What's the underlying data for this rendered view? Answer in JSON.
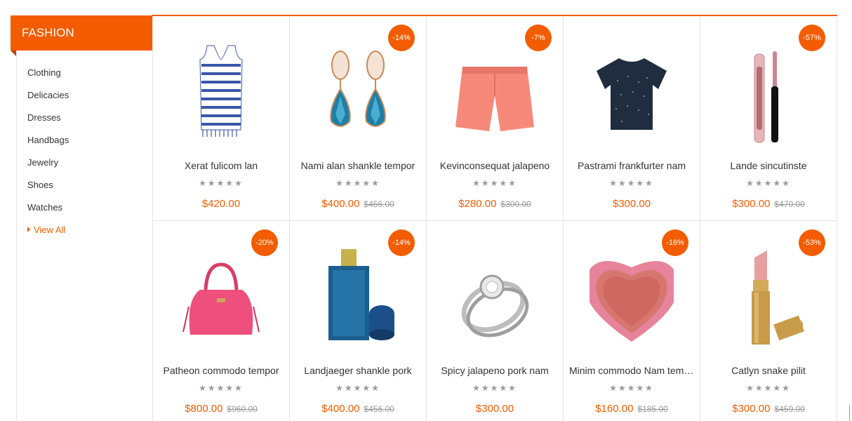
{
  "sidebar": {
    "title": "FASHION",
    "items": [
      "Clothing",
      "Delicacies",
      "Dresses",
      "Handbags",
      "Jewelry",
      "Shoes",
      "Watches"
    ],
    "view_all": "View All"
  },
  "colors": {
    "accent": "#f35c00",
    "border": "#e5e5e5"
  },
  "products": [
    {
      "name": "Xerat fulicom lan",
      "price": "$420.00",
      "old_price": "",
      "badge": "",
      "image": "striped-tank-top",
      "rating": 0
    },
    {
      "name": "Nami alan shankle tempor",
      "price": "$400.00",
      "old_price": "$456.00",
      "badge": "-14%",
      "image": "blue-crystal-earrings",
      "rating": 0
    },
    {
      "name": "Kevinconsequat jalapeno",
      "price": "$280.00",
      "old_price": "$300.00",
      "badge": "-7%",
      "image": "coral-shorts",
      "rating": 0
    },
    {
      "name": "Pastrami frankfurter nam",
      "price": "$300.00",
      "old_price": "",
      "badge": "",
      "image": "navy-tshirt",
      "rating": 0
    },
    {
      "name": "Lande sincutinste",
      "price": "$300.00",
      "old_price": "$470.00",
      "badge": "-57%",
      "image": "lip-gloss",
      "rating": 0
    },
    {
      "name": "Patheon commodo tempor",
      "price": "$800.00",
      "old_price": "$960.00",
      "badge": "-20%",
      "image": "pink-handbag",
      "rating": 0
    },
    {
      "name": "Landjaeger shankle pork",
      "price": "$400.00",
      "old_price": "$456.00",
      "badge": "-14%",
      "image": "perfume-bottle",
      "rating": 0
    },
    {
      "name": "Spicy jalapeno pork nam",
      "price": "$300.00",
      "old_price": "",
      "badge": "",
      "image": "diamond-ring",
      "rating": 0
    },
    {
      "name": "Minim commodo Nam tempor",
      "price": "$160.00",
      "old_price": "$185.00",
      "badge": "-16%",
      "image": "heart-blush-compact",
      "rating": 0
    },
    {
      "name": "Catlyn snake pilit",
      "price": "$300.00",
      "old_price": "$459.00",
      "badge": "-53%",
      "image": "lipstick",
      "rating": 0
    }
  ]
}
